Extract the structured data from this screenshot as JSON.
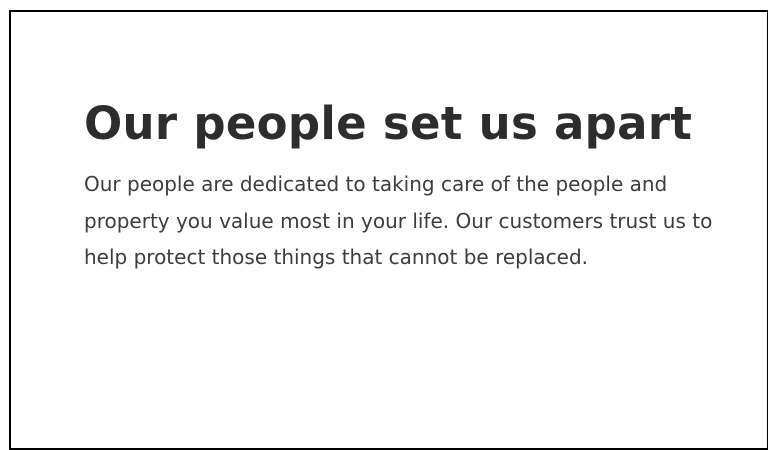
{
  "section": {
    "heading": "Our people set us apart",
    "body": "Our people are dedicated to taking care of the people and property you value most in your life. Our customers trust us to help protect those things that cannot be replaced."
  }
}
